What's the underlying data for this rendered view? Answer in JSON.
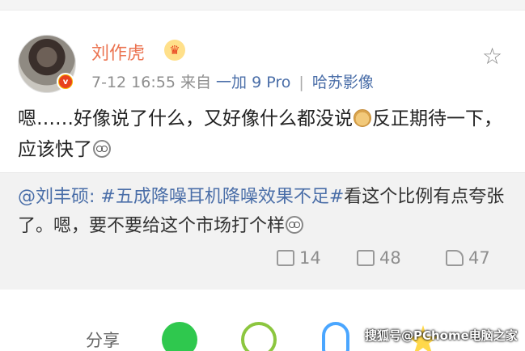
{
  "post": {
    "username": "刘作虎",
    "meta": {
      "time": "7-12 16:55",
      "from_label": "来自",
      "device": "一加 9 Pro",
      "separator": "|",
      "camera": "哈苏影像"
    },
    "content": {
      "part1": "嗯……好像说了什么，又好像什么都没说",
      "part2": "反正期待一下，应该快了"
    }
  },
  "repost": {
    "mention": "@刘丰硕:",
    "hashtag": "#五成降噪耳机降噪效果不足#",
    "text": "看这个比例有点夸张了。嗯，要不要给这个市场打个样"
  },
  "actions": {
    "repost_count": "14",
    "comment_count": "48",
    "like_count": "47"
  },
  "share": {
    "label": "分享"
  },
  "watermark": "搜狐号@PChome电脑之家",
  "icons": {
    "avatar": "user-avatar",
    "verified": "verified-v-badge",
    "crown": "crown-icon",
    "star": "star-outline-icon",
    "doge": "doge-emoji",
    "sweat": "awkward-emoji",
    "repost": "repost-icon",
    "comment": "comment-icon",
    "like": "thumbs-up-icon",
    "wechat": "wechat-icon",
    "moments": "moments-icon",
    "qq": "qq-icon",
    "qzone": "qzone-icon"
  },
  "colors": {
    "username": "#eb7350",
    "link": "#4a6ea8",
    "meta": "#8e8e8e",
    "repost_bg": "#f2f2f2"
  }
}
